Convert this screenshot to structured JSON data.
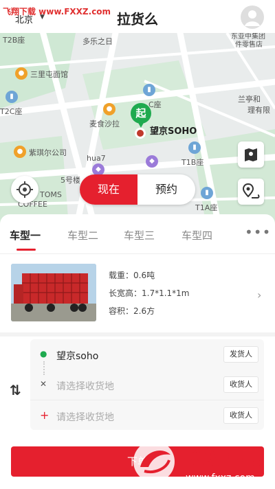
{
  "header": {
    "watermark": "飞翔下载 www.FXXZ.com",
    "city": "北京",
    "title": "拉货么"
  },
  "map": {
    "pois": {
      "t2b": "T2B座",
      "duole": "多乐之日",
      "sanli": "三里屯面馆",
      "t2c": "T2C座",
      "c_zuo": "C座",
      "maishi": "麦食沙拉",
      "lanting": "兰亭和",
      "lanting2": "理有限",
      "zikeer": "紫琪尔公司",
      "hua7": "hua7",
      "t1b": "T1B座",
      "five": "5号楼",
      "toms": "TOMS",
      "coffee": "COFFEE",
      "t1a": "T1A座",
      "top_right": "东亚中集团",
      "top_right2": "件零售店"
    },
    "pin_badge": "起",
    "pin_label": "望京SOHO",
    "toggle": {
      "now": "现在",
      "book": "预约"
    }
  },
  "vehicle": {
    "tabs": [
      "车型一",
      "车型二",
      "车型三",
      "车型四"
    ],
    "more": "•••",
    "load": "载重：0.6吨",
    "dimensions": "长宽高：1.7*1.1*1m",
    "volume": "容积：2.6方"
  },
  "address": {
    "swap_icon": "⇅",
    "rows": [
      {
        "mark": "●",
        "mark_color": "#1faa4f",
        "text": "望京soho",
        "button": "发货人"
      },
      {
        "mark": "✕",
        "mark_color": "#555555",
        "text": "请选择收货地",
        "button": "收货人"
      },
      {
        "mark": "+",
        "mark_color": "#e5202e",
        "text": "请选择收货地",
        "button": "收货人"
      }
    ]
  },
  "submit": {
    "label": "下单"
  },
  "brand_watermark": {
    "line1": "飞翔下载",
    "line2": "www.fxxz.com"
  },
  "colors": {
    "accent": "#e5202e",
    "start_green": "#1faa4f"
  }
}
